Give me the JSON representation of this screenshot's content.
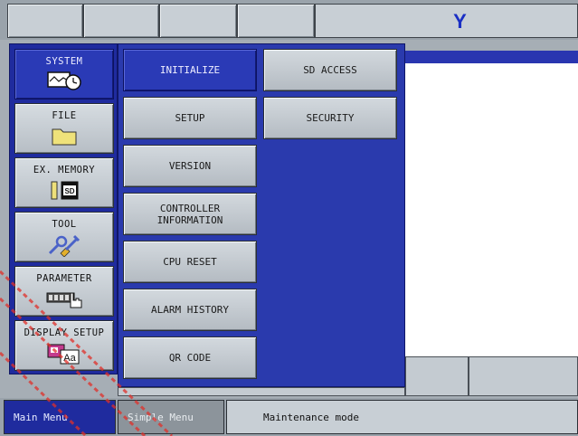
{
  "header": {
    "title": "Y",
    "blank_buttons": 4
  },
  "left_menu": {
    "items": [
      {
        "label": "SYSTEM",
        "icon": "clock-window-icon",
        "selected": true
      },
      {
        "label": "FILE",
        "icon": "folder-icon",
        "selected": false
      },
      {
        "label": "EX. MEMORY",
        "icon": "sd-card-icon",
        "selected": false
      },
      {
        "label": "TOOL",
        "icon": "wrench-tool-icon",
        "selected": false
      },
      {
        "label": "PARAMETER",
        "icon": "parameter-hand-icon",
        "selected": false
      },
      {
        "label": "DISPLAY SETUP",
        "icon": "display-font-icon",
        "selected": false
      }
    ]
  },
  "submenu": {
    "col1": [
      {
        "label": "INITIALIZE",
        "selected": true
      },
      {
        "label": "SETUP",
        "selected": false
      },
      {
        "label": "VERSION",
        "selected": false
      },
      {
        "label": "CONTROLLER\nINFORMATION",
        "selected": false
      },
      {
        "label": "CPU RESET",
        "selected": false
      },
      {
        "label": "ALARM HISTORY",
        "selected": false
      },
      {
        "label": "QR CODE",
        "selected": false
      }
    ],
    "col2": [
      {
        "label": "SD ACCESS",
        "selected": false
      },
      {
        "label": "SECURITY",
        "selected": false
      }
    ]
  },
  "bottom_bar": {
    "main_menu": "Main Menu",
    "simple_menu": "Simple Menu",
    "status": "Maintenance mode"
  },
  "colors": {
    "accent_blue": "#1f2b9e",
    "title_blue": "#1a2fc4",
    "panel_gray": "#c8cfd5",
    "watermark": "#e0302a"
  }
}
